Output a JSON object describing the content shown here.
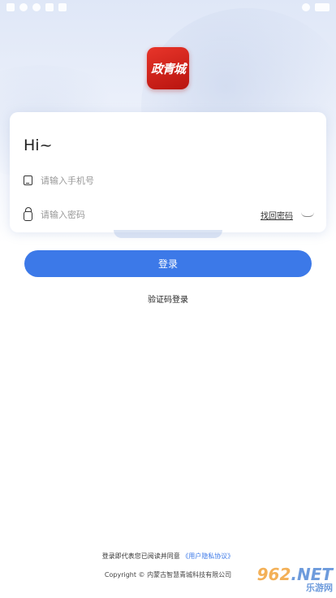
{
  "status_bar": {
    "left_icons": [
      "signal-icon",
      "app-icon",
      "app-icon",
      "download-icon",
      "app-icon"
    ],
    "right_icons": [
      "wifi-icon",
      "battery-icon"
    ]
  },
  "app": {
    "logo_text": "政青城",
    "logo_color": "#d9241c"
  },
  "login_form": {
    "greeting": "Hi~",
    "phone_placeholder": "请输入手机号",
    "password_placeholder": "请输入密码",
    "forgot_password": "找回密码",
    "submit_label": "登录",
    "code_login_label": "验证码登录"
  },
  "footer": {
    "agreement_prefix": "登录即代表您已阅读并同意",
    "agreement_link": "《用户隐私协议》",
    "copyright": "Copyright © 内蒙古智慧青城科技有限公司"
  },
  "watermark": {
    "number": "962",
    "suffix": ".NET",
    "site": "乐游网"
  },
  "colors": {
    "accent": "#3c79e8",
    "text": "#222222",
    "placeholder": "#999999"
  }
}
